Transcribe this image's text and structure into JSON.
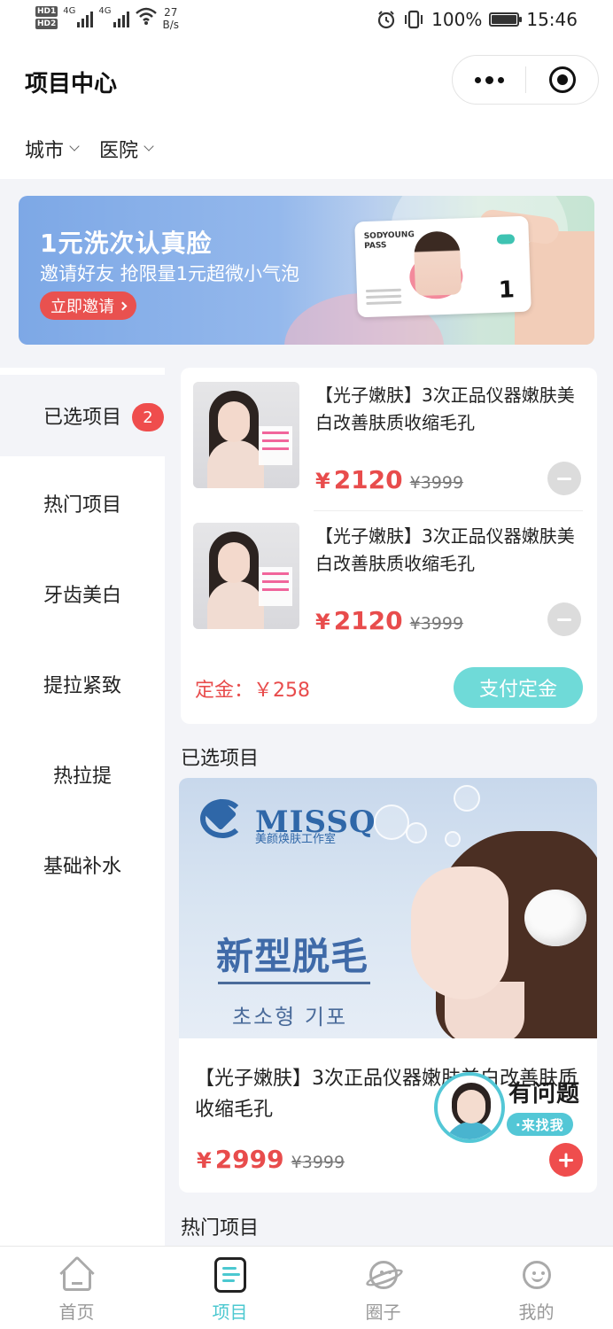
{
  "status_bar": {
    "hd_labels": [
      "HD1",
      "HD2"
    ],
    "net_labels": [
      "4G",
      "4G"
    ],
    "speed_value": "27",
    "speed_unit": "B/s",
    "battery": "100%",
    "time": "15:46"
  },
  "header": {
    "title": "项目中心",
    "filters": [
      {
        "label": "城市"
      },
      {
        "label": "医院"
      }
    ]
  },
  "banner": {
    "title": "1元洗次认真脸",
    "subtitle": "邀请好友 抢限量1元超微小气泡",
    "button_label": "立即邀请",
    "card_brand": "SODYOUNG PASS",
    "card_value": "1"
  },
  "sidenav": {
    "items": [
      {
        "label": "已选项目",
        "badge": "2"
      },
      {
        "label": "热门项目"
      },
      {
        "label": "牙齿美白"
      },
      {
        "label": "提拉紧致"
      },
      {
        "label": "热拉提"
      },
      {
        "label": "基础补水"
      }
    ]
  },
  "selected": {
    "items": [
      {
        "title": "【光子嫩肤】3次正品仪器嫩肤美白改善肤质收缩毛孔",
        "currency": "¥",
        "price": "2120",
        "original_price": "¥3999"
      },
      {
        "title": "【光子嫩肤】3次正品仪器嫩肤美白改善肤质收缩毛孔",
        "currency": "¥",
        "price": "2120",
        "original_price": "¥3999"
      }
    ],
    "deposit_label": "定金：￥258",
    "pay_button": "支付定金"
  },
  "sections": {
    "selected_label": "已选项目",
    "hot_label": "热门项目"
  },
  "product": {
    "brand": "MISSQ",
    "brand_sub": "美颜焕肤工作室",
    "headline_a": "新型",
    "headline_b": "脱毛",
    "korean": "초소형 기포",
    "title": "【光子嫩肤】3次正品仪器嫩肤美白改善肤质收缩毛孔",
    "currency": "¥",
    "price": "2999",
    "original_price": "¥3999"
  },
  "support": {
    "question": "有问题",
    "find": "·来找我"
  },
  "tabbar": {
    "tabs": [
      {
        "label": "首页",
        "icon": "home-icon"
      },
      {
        "label": "项目",
        "icon": "project-icon",
        "active": true
      },
      {
        "label": "圈子",
        "icon": "planet-icon"
      },
      {
        "label": "我的",
        "icon": "smile-face-icon"
      }
    ]
  },
  "colors": {
    "accent": "#4bc8d0",
    "price_red": "#e84c4c",
    "badge_red": "#ef4d4d",
    "pay_button": "#6fdad8"
  }
}
